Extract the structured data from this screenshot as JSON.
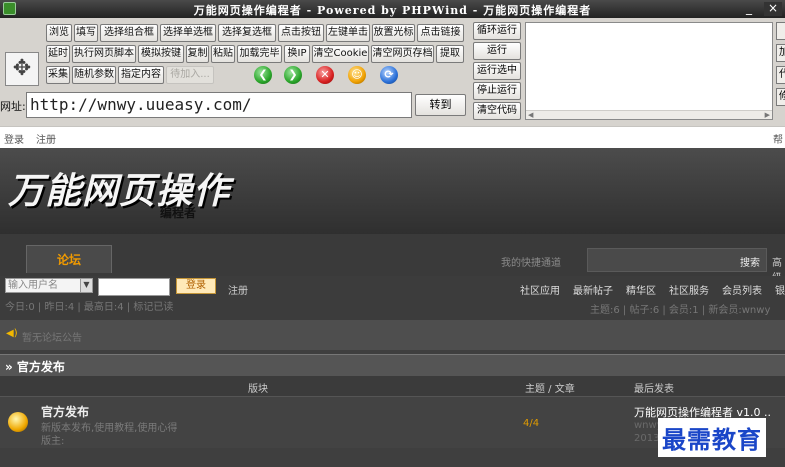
{
  "window": {
    "title": "万能网页操作编程者 - Powered by PHPWind - 万能网页操作编程者",
    "close": "×",
    "minimize": "_"
  },
  "toolbar": {
    "row1": [
      "浏览",
      "填写",
      "选择组合框",
      "选择单选框",
      "选择复选框",
      "点击按钮",
      "左键单击",
      "放置光标",
      "点击链接"
    ],
    "row2": [
      "延时",
      "执行网页脚本",
      "模拟按键",
      "复制",
      "粘贴",
      "加载完毕",
      "换IP",
      "清空Cookie",
      "清空网页存档",
      "提取"
    ],
    "row3": [
      "采集",
      "随机参数",
      "指定内容",
      "待加入..."
    ],
    "run_buttons": [
      "循环运行",
      "运行",
      "运行选中",
      "停止运行",
      "清空代码"
    ],
    "side_buttons": [
      "",
      "加",
      "代",
      "修"
    ],
    "url_label": "网址:",
    "url_value": "http://wnwy.uueasy.com/",
    "go_label": "转到"
  },
  "icons": [
    "dpad-icon",
    "back-icon",
    "forward-icon",
    "stop-icon",
    "refresh-icon",
    "home-icon"
  ],
  "colors": {
    "green": "#2aa52a",
    "red": "#d82020",
    "orange": "#f0a000",
    "blue": "#2a70d8"
  },
  "login_bar": {
    "login": "登录",
    "register": "注册",
    "right": "帮"
  },
  "site": {
    "logo": "万能网页操作",
    "logo_sub": "编程者",
    "tab": "论坛",
    "quick": "我的快捷通道",
    "search_btn": "搜索",
    "advanced": "高级",
    "user_placeholder": "输入用户名",
    "login_btn": "登录",
    "register": "注册",
    "nav": [
      "社区应用",
      "最新帖子",
      "精华区",
      "社区服务",
      "会员列表",
      "银"
    ],
    "stats_left": "今日:0 | 昨日:4 | 最高日:4 | 标记已读",
    "stats_right": "主题:6 | 帖子:6 | 会员:1 | 新会员:wnwy",
    "notice": "暂无论坛公告",
    "section": "» 官方发布",
    "col_block": "版块",
    "col_topics": "主题 / 文章",
    "col_last": "最后发表",
    "forum_name": "官方发布",
    "forum_desc": "新版本发布,使用教程,使用心得",
    "forum_mod": "版主:",
    "forum_count": "4/4",
    "last_post": "万能网页操作编程者 v1.0 ..",
    "last_by": "wnwy",
    "last_date": "2013"
  },
  "watermark": "最需教育"
}
